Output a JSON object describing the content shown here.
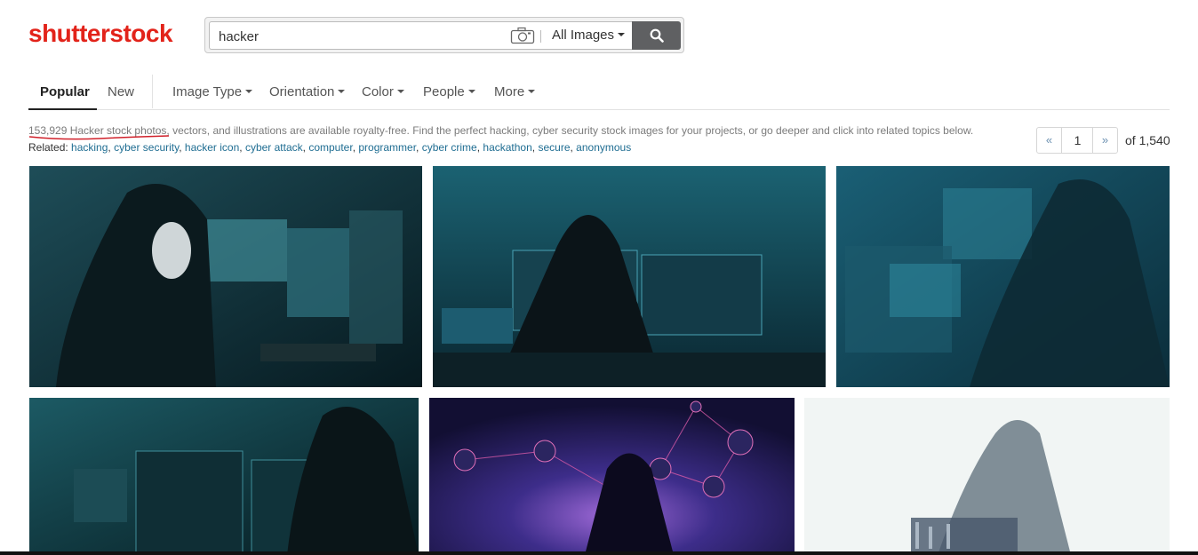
{
  "logo": {
    "text": "shutterstock",
    "color": "#e2231a"
  },
  "search": {
    "query": "hacker",
    "placeholder": "",
    "filter_label": "All Images",
    "camera_icon": "camera-icon",
    "button_icon": "search-icon"
  },
  "nav": {
    "tabs": [
      {
        "label": "Popular",
        "active": true
      },
      {
        "label": "New",
        "active": false
      }
    ],
    "filters": [
      "Image Type",
      "Orientation",
      "Color",
      "People",
      "More"
    ]
  },
  "results": {
    "summary": "153,929 Hacker stock photos, vectors, and illustrations are available royalty-free. Find the perfect hacking, cyber security stock images for your projects, or go deeper and click into related topics below.",
    "related_label": "Related:",
    "related_topics": [
      "hacking",
      "cyber security",
      "hacker icon",
      "cyber attack",
      "computer",
      "programmer",
      "cyber crime",
      "hackathon",
      "secure",
      "anonymous"
    ]
  },
  "pagination": {
    "prev": "«",
    "current": "1",
    "next": "»",
    "of": "of 1,540"
  },
  "images": [
    {
      "alt": "hacker in mask at computer"
    },
    {
      "alt": "hooded hacker with monitors"
    },
    {
      "alt": "hacker with code overlay"
    },
    {
      "alt": "hooded hacker at monitors"
    },
    {
      "alt": "hacker with network graph"
    },
    {
      "alt": "hooded figure double exposure city"
    }
  ],
  "colors": {
    "accent_link": "#1f6d92",
    "search_button": "#5f6062"
  }
}
